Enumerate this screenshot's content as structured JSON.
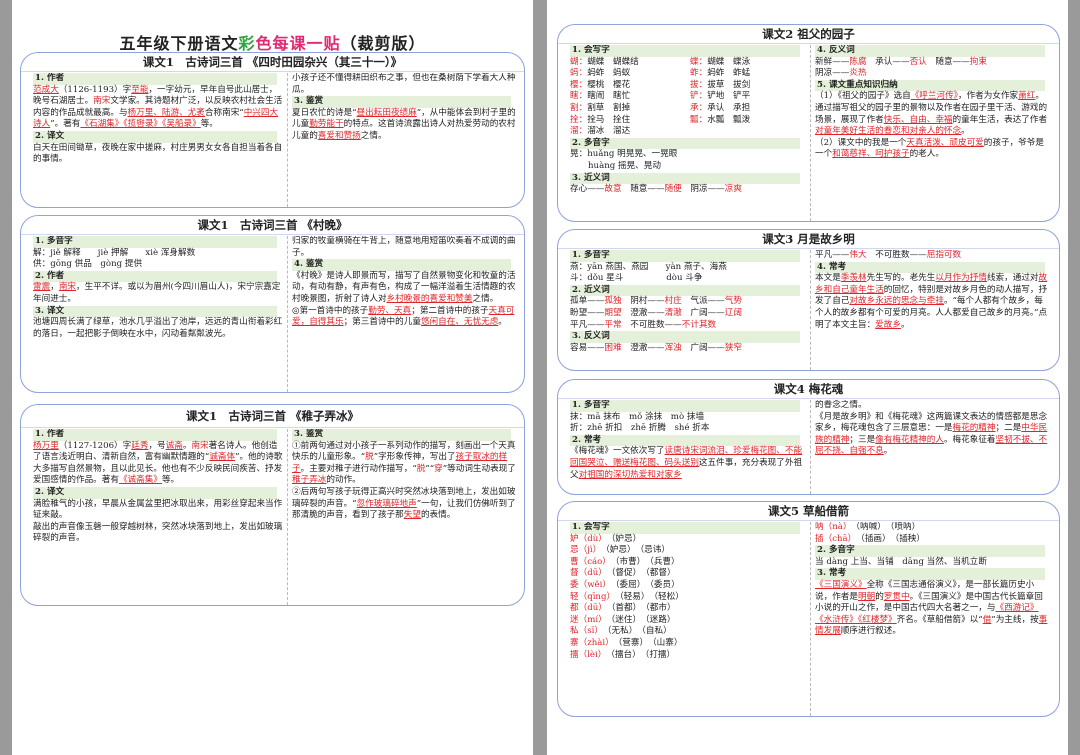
{
  "title": {
    "part1": "五年级下册语文",
    "part2": "彩",
    "part3": "色",
    "part4": "每课一贴",
    "part5": "（裁剪版）"
  },
  "card1": {
    "title": "课文1　古诗词三首 《四时田园杂兴（其三十一）》",
    "sec_author": "1. 作者",
    "author_name": "范成大",
    "author_t1": "（1126-1193）字",
    "author_zi": "至能",
    "author_t2": "，一字幼元，早年自号此山居士，晚号石湖居士。",
    "author_era": "南宋",
    "author_t3": "文学家。其诗题材广泛，以反映农村社会生活内容的作品成就最高。与",
    "author_poets": "杨万里、陆游、尤袤",
    "author_t4": "合称南宋“",
    "author_four": "中兴四大诗人",
    "author_t5": "”。著有",
    "author_works": "《石湖集》《揽辔录》《吴船录》",
    "author_t6": "等。",
    "sec_trans": "2. 译文",
    "trans_text": "白天在田间锄草，夜晚在家中搓麻，村庄男男女女各自担当着各自的事情。",
    "trans_cont": "小孩子还不懂得耕田织布之事，但也在桑树荫下学着大人种瓜。",
    "sec_appr": "3. 鉴赏",
    "appr_t1": "夏日农忙的诗是“",
    "appr_hl1": "昼出耘田夜绩麻",
    "appr_t2": "”，从中能体会到村子里的儿童",
    "appr_hl2": "勤劳能干",
    "appr_t3": "的特点。这首诗流露出诗人对热爱劳动的农村儿童的",
    "appr_hl3": "喜爱和赞扬",
    "appr_t4": "之情。"
  },
  "card2": {
    "title": "课文1　古诗词三首 《村晚》",
    "sec_poly": "1. 多音字",
    "poly1": "解：jiě 解释　　jiè 押解　　xiè 浑身解数",
    "poly2": "供：gōng 供品　gòng 提供",
    "sec_author": "2. 作者",
    "author_name": "雷震",
    "author_era": "南宋",
    "author_t1": "，生平不详。或以为眉州(今四川眉山人)，宋宁宗嘉定年间进士。",
    "sec_trans": "3. 译文",
    "trans_text": "池塘四周长满了绿草，池水几乎溢出了池岸，远远的青山衔着彩红的落日，一起把影子倒映在水中，闪动着粼粼波光。",
    "trans_cont": "归家的牧童横骑在牛背上，随意地用短笛吹奏着不成调的曲子。",
    "sec_appr": "4. 鉴赏",
    "appr_t1": "《村晚》是诗人即景而写，描写了自然景物变化和牧童的活动，有动有静，有声有色，构成了一幅洋溢着生活情趣的农村晚景图，折射了诗人对",
    "appr_hl1": "乡村晚景的喜爱和赞美",
    "appr_t2": "之情。",
    "appr_t3": "◎第一首诗中的孩子",
    "appr_hl2": "勤劳、天真",
    "appr_t4": "；第二首诗中的孩子",
    "appr_hl3": "天真可爱，自得其乐",
    "appr_t5": "；第三首诗中的儿童",
    "appr_hl4": "悠闲自在、无忧无虑",
    "appr_t6": "。"
  },
  "card3": {
    "title": "课文1　古诗词三首 《稚子弄冰》",
    "sec_author": "1. 作者",
    "author_name": "杨万里",
    "author_t1": "（1127-1206）字",
    "author_zi": "廷秀",
    "author_t2": "，号",
    "author_hao": "诚斋",
    "author_t3": "。",
    "author_era": "南宋",
    "author_t4": "著名诗人。他创造了语言浅近明白、清新自然，富有幽默情趣的“",
    "author_style": "诚斋体",
    "author_t5": "”。他的诗歌大多描写自然景物，且以此见长。他也有不少反映民间疾苦、抒发爱国感情的作品。著有",
    "author_works": "《诚斋集》",
    "author_t6": "等。",
    "sec_trans": "2. 译文",
    "trans_text": "满脸稚气的小孩，早晨从金属盆里把冰取出来，用彩丝穿起来当作钲来敲。",
    "trans_cont": "敲出的声音像玉磬一般穿越树林，突然冰块落到地上，发出如玻璃碎裂的声音。",
    "sec_appr": "3. 鉴赏",
    "appr_t1": "①前两句通过对小孩子一系列动作的描写，刻画出一个天真快乐的儿童形象。“",
    "appr_c1": "脱",
    "appr_t2": "”字形象传神，写出了",
    "appr_hl1": "孩子取冰的样子",
    "appr_t3": "。主要对稚子进行动作描写，“",
    "appr_c2": "脱",
    "appr_t4": "”“",
    "appr_c3": "穿",
    "appr_t5": "”等动词生动表现了",
    "appr_hl2": "稚子弄冰",
    "appr_t6": "的动作。",
    "appr_t7": "②后两句写孩子玩得正高兴时突然冰块落到地上，发出如玻璃碎裂的声音。“",
    "appr_hl3": "忽作玻璃碎地声",
    "appr_t8": "”一句，让我们仿佛听到了那清脆的声音，看到了孩子那",
    "appr_hl4": "失望",
    "appr_t9": "的表情。"
  },
  "card4": {
    "title": "课文2 祖父的园子",
    "sec_write": "1. 会写字",
    "write_rows": [
      [
        "蝴：",
        "蝴蝶　蝴蝶结",
        "蝶：",
        "蝴蝶　蝶泳"
      ],
      [
        "蚂：",
        "蚂蚱　蚂蚁",
        "蚱：",
        "蚂蚱　蚱蜢"
      ],
      [
        "樱：",
        "樱桃　樱花",
        "拔：",
        "拔草　拔剑"
      ],
      [
        "瞎：",
        "瞎闹　瞎忙",
        "铲：",
        "铲地　铲平"
      ],
      [
        "割：",
        "割草　割掉",
        "承：",
        "承认　承担"
      ],
      [
        "拴：",
        "拴马　拴住",
        "瓢：",
        "水瓢　瓢泼"
      ],
      [
        "溜：",
        "溜冰　溜达",
        "",
        ""
      ]
    ],
    "sec_poly": "2. 多音字",
    "poly1": "晃：huǎng 明晃晃、一晃眼",
    "poly2": "huàng 摇晃、晃动",
    "sec_syn": "3. 近义词",
    "syn_t1": "存心——",
    "syn_a1": "故意",
    "syn_t2": "　随意——",
    "syn_a2": "随便",
    "syn_t3": "　阴凉——",
    "syn_a3": "凉爽",
    "sec_ant": "4. 反义词",
    "ant_t1": "新鲜——",
    "ant_a1": "陈腐",
    "ant_t2": "　承认——",
    "ant_a2": "否认",
    "ant_t3": "　随意——",
    "ant_a3": "拘束",
    "ant_t4": "阴凉——",
    "ant_a4": "炎热",
    "sec_key": "5. 课文重点知识归纳",
    "key_t1": "（1）《祖父的园子》选自",
    "key_hl1": "《呼兰河传》",
    "key_t2": "，作者为女作家",
    "key_hl2": "萧红",
    "key_t3": "。通过描写祖父的园子里的景物以及作者在园子里干活、游戏的场景，展现了作者",
    "key_hl3": "快乐、自由、幸福",
    "key_t4": "的童年生活，表达了作者",
    "key_hl4": "对童年美好生活的眷恋和对亲人的怀念",
    "key_t5": "。",
    "key_t6": "（2）课文中的我是一个",
    "key_hl5": "天真活泼、顽皮可爱",
    "key_t7": "的孩子，爷爷是一个",
    "key_hl6": "和蔼慈祥、呵护孩子",
    "key_t8": "的老人。"
  },
  "card5": {
    "title": "课文3 月是故乡明",
    "sec_poly": "1. 多音字",
    "poly1": "燕：yān 燕国、燕园　　yàn 燕子、海燕",
    "poly2": "斗：dǒu 星斗　　　　　dòu 斗争",
    "sec_syn": "2. 近义词",
    "syn_rows": [
      [
        "孤单——",
        "孤独",
        "　阴村——",
        "村庄",
        "　气派——",
        "气势"
      ],
      [
        "盼望——",
        "期望",
        "　澄澈——",
        "清澈",
        "　广阔——",
        "辽阔"
      ],
      [
        "平凡——",
        "平常",
        "　不可胜数——",
        "不计其数",
        "",
        ""
      ]
    ],
    "sec_ant": "3. 反义词",
    "ant_rows": [
      [
        "容易——",
        "困难",
        "　澄澈——",
        "浑浊",
        "　广阔——",
        "狭窄"
      ]
    ],
    "r_t1": "平凡——",
    "r_a1": "伟大",
    "r_t2": "　不可胜数——",
    "r_a2": "屈指可数",
    "sec_know": "4. 常考",
    "know_t1": "本文是",
    "know_hl1": "季羡林",
    "know_t2": "先生写的。老先生",
    "know_hl2": "以月作为抒情",
    "know_t3": "线索，通过对",
    "know_hl3": "故乡和自己童年生活",
    "know_t4": "的回忆，特别是对故乡月色的动人描写，抒发了自己",
    "know_hl4": "对故乡永远的思念与牵挂",
    "know_t5": "。“每个人都有个故乡，每个人的故乡都有个可爱的月亮。人人都爱自己故乡的月亮。”点明了本文主旨：",
    "know_hl5": "爱故乡",
    "know_t6": "。"
  },
  "card6": {
    "title": "课文4 梅花魂",
    "sec_poly": "1. 多音字",
    "poly1": "抹：mā 抹布　mǒ 涂抹　mò 抹墙",
    "poly2": "折：zhē 折扣　zhē 折腾　shé 折本",
    "sec_know": "2. 常考",
    "know_t1": "《梅花魂》一文依次写了",
    "know_hl1": "读唐诗宋词流泪、珍爱梅花图、不能回国哭泣、赠送梅花图、码头送别",
    "know_t2": "这五件事，充分表现了外祖父",
    "know_hl2": "对祖国的深切热爱和对家乡",
    "know_t3": "的眷念之情。",
    "know_t4": "《月是故乡明》和《梅花魂》这两篇课文表达的情感都是思念家乡，梅花魂包含了三层意思：一是",
    "know_hl3": "梅花的精神",
    "know_t5": "；二是",
    "know_hl4": "中华民族的精神",
    "know_t6": "；三是",
    "know_hl5": "像有梅花精神的人",
    "know_t7": "。梅花象征着",
    "know_hl6": "坚韧不拔、不屈不挠、自强不息",
    "know_t8": "。"
  },
  "card7": {
    "title": "课文5 草船借箭",
    "sec_write": "1. 会写字",
    "write_rows": [
      [
        "妒（dù）",
        "（妒忌）",
        ""
      ],
      [
        "忌（jì）",
        "（妒忌）",
        "（忌讳）"
      ],
      [
        "曹（cáo）",
        "（市曹）",
        "（兵曹）"
      ],
      [
        "督（dū）",
        "（督促）",
        "（都督）"
      ],
      [
        "委（wěi）",
        "（委屈）",
        "（委员）"
      ],
      [
        "惩（chéng）",
        "（惩罚）",
        "（严惩）"
      ],
      [
        "寨（zhài）",
        "（营寨）",
        "（山寨）"
      ],
      [
        "擂（lèi）",
        "（擂台）",
        "（打擂）"
      ]
    ],
    "write_fix": [
      "轻（qīng）",
      "（轻易）",
      "（轻松）"
    ],
    "write_fix2": [
      "都（dū）",
      "（首都）",
      "（都市）"
    ],
    "write_fix3": [
      "迷（mí）",
      "（迷住）",
      "（迷路）"
    ],
    "write_fix4": [
      "私（sī）",
      "（无私）",
      "（自私）"
    ],
    "write_right": [
      [
        "呐（nà）",
        "（呐喊）",
        "（喷呐）"
      ],
      [
        "插（chā）",
        "（插画）",
        "（插秧）"
      ]
    ],
    "sec_poly": "2. 多音字",
    "poly1": "当 dàng 上当、当铺　dāng 当然、当机立断",
    "sec_know": "3. 常考",
    "know_t1": "",
    "know_hl1": "《三国演义》",
    "know_t2": "全称《三国志通俗演义》，是一部长篇历史小说，作者是",
    "know_hl2": "明朝",
    "know_t3": "的",
    "know_hl3": "罗贯中",
    "know_t4": "。《三国演义》是中国古代长篇章回小说的开山之作，是中国古代四大名著之一，与",
    "know_hl4": "《西游记》《水浒传》《红楼梦》",
    "know_t5": "齐名。《草船借箭》以“",
    "know_hl5": "借",
    "know_t6": "”为主线，按",
    "know_hl6": "事情发展",
    "know_t7": "顺序进行叙述。"
  }
}
